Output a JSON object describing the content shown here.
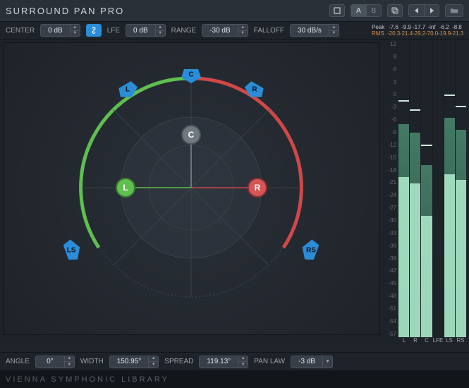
{
  "title": "SURROUND PAN PRO",
  "header": {
    "ab_a": "A",
    "ab_b": "B"
  },
  "top_params": {
    "center_label": "CENTER",
    "center_value": "0 dB",
    "lfe_label": "LFE",
    "lfe_value": "0 dB",
    "range_label": "RANGE",
    "range_value": "-30 dB",
    "falloff_label": "FALLOFF",
    "falloff_value": "30 dB/s"
  },
  "bottom_params": {
    "angle_label": "ANGLE",
    "angle_value": "0°",
    "width_label": "WIDTH",
    "width_value": "150.95°",
    "spread_label": "SPREAD",
    "spread_value": "119.13°",
    "panlaw_label": "PAN LAW",
    "panlaw_value": "-3 dB"
  },
  "speakers": {
    "c": "C",
    "l": "L",
    "r": "R",
    "ls": "LS",
    "rs": "RS"
  },
  "nodes": {
    "c": "C",
    "l": "L",
    "r": "R"
  },
  "meters": {
    "peak_label": "Peak",
    "rms_label": "RMS",
    "channels": [
      "L",
      "R",
      "C",
      "LFE",
      "LS",
      "RS"
    ],
    "peak_values": [
      "-7.6",
      "-9.9",
      "-17.7",
      "-inf",
      "-6.2",
      "-8.8"
    ],
    "rms_values": [
      "-20.3",
      "-21.4",
      "-29.2",
      "-70.0",
      "-19.9",
      "-21.3"
    ],
    "scale": [
      "12",
      "9",
      "6",
      "3",
      "0",
      "-3",
      "-6",
      "-9",
      "-12",
      "-15",
      "-18",
      "-21",
      "-24",
      "-27",
      "-30",
      "-33",
      "-36",
      "-39",
      "-42",
      "-45",
      "-48",
      "-51",
      "-54",
      "-57"
    ],
    "bars": [
      {
        "peak_pct": 28,
        "rms_pct": 46,
        "tick_pct": 20
      },
      {
        "peak_pct": 31,
        "rms_pct": 48,
        "tick_pct": 23
      },
      {
        "peak_pct": 42,
        "rms_pct": 59,
        "tick_pct": 35
      },
      {
        "peak_pct": 100,
        "rms_pct": 100,
        "tick_pct": 100
      },
      {
        "peak_pct": 26,
        "rms_pct": 45,
        "tick_pct": 18
      },
      {
        "peak_pct": 30,
        "rms_pct": 47,
        "tick_pct": 22
      }
    ]
  },
  "footer": "VIENNA SYMPHONIC LIBRARY"
}
